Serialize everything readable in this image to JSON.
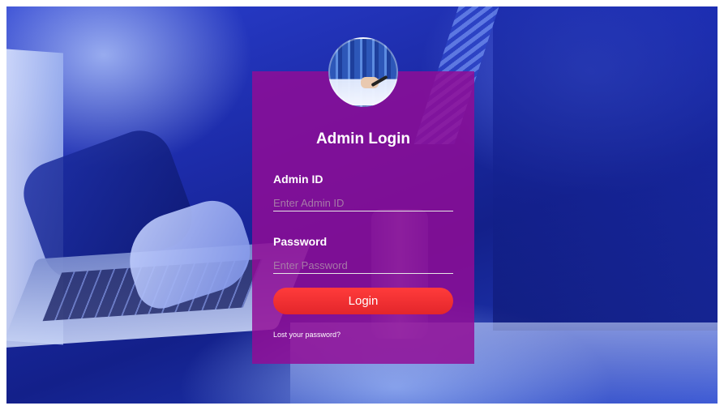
{
  "login": {
    "title": "Admin Login",
    "admin_id_label": "Admin ID",
    "admin_id_placeholder": "Enter Admin ID",
    "admin_id_value": "",
    "password_label": "Password",
    "password_placeholder": "Enter Password",
    "password_value": "",
    "login_button": "Login",
    "lost_password_link": "Lost your password?"
  },
  "colors": {
    "card": "#910C96",
    "button": "#E8272D",
    "background": "#1C2BA8"
  },
  "icons": {
    "avatar": "business-avatar-icon"
  }
}
